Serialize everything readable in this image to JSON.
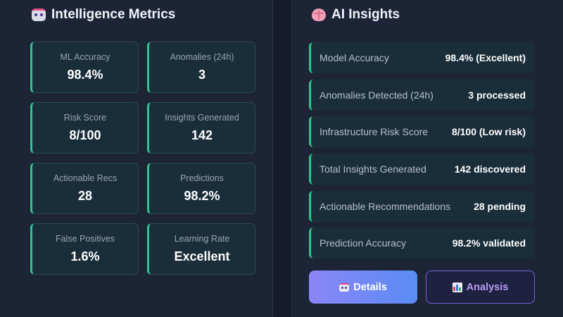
{
  "metrics_panel": {
    "title": "Intelligence Metrics",
    "icon": "robot-icon",
    "cards": [
      {
        "label": "ML Accuracy",
        "value": "98.4%"
      },
      {
        "label": "Anomalies (24h)",
        "value": "3"
      },
      {
        "label": "Risk Score",
        "value": "8/100"
      },
      {
        "label": "Insights Generated",
        "value": "142"
      },
      {
        "label": "Actionable Recs",
        "value": "28"
      },
      {
        "label": "Predictions",
        "value": "98.2%"
      },
      {
        "label": "False Positives",
        "value": "1.6%"
      },
      {
        "label": "Learning Rate",
        "value": "Excellent"
      }
    ]
  },
  "insights_panel": {
    "title": "AI Insights",
    "icon": "brain-icon",
    "rows": [
      {
        "label": "Model Accuracy",
        "value": "98.4% (Excellent)"
      },
      {
        "label": "Anomalies Detected (24h)",
        "value": "3 processed"
      },
      {
        "label": "Infrastructure Risk Score",
        "value": "8/100 (Low risk)"
      },
      {
        "label": "Total Insights Generated",
        "value": "142 discovered"
      },
      {
        "label": "Actionable Recommendations",
        "value": "28 pending"
      },
      {
        "label": "Prediction Accuracy",
        "value": "98.2% validated"
      }
    ]
  },
  "buttons": {
    "details_label": "Details",
    "details_icon": "robot-icon",
    "analysis_label": "Analysis",
    "analysis_icon": "bar-chart-icon"
  },
  "colors": {
    "background": "#161b2c",
    "panel": "#1c2436",
    "card": "#1a2e3a",
    "accent_green": "#2fc48f",
    "accent_purple": "#8b86f6",
    "accent_blue": "#5a8cf5"
  }
}
